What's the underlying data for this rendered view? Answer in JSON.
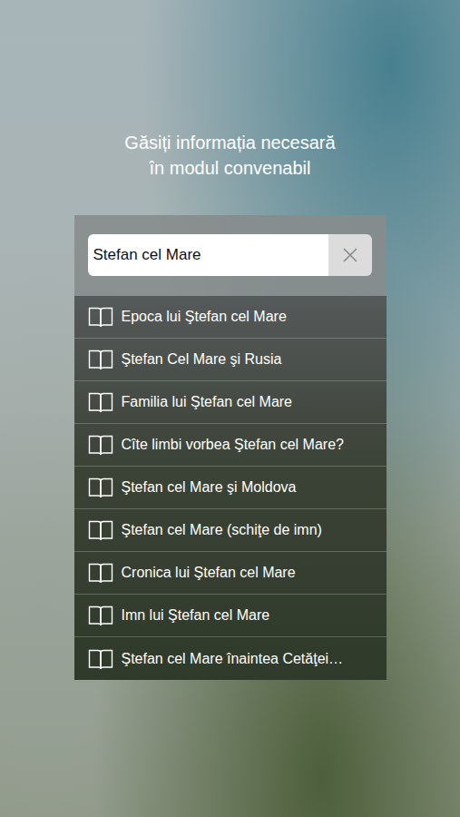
{
  "headline": [
    "Găsiți informația necesară",
    "în modul convenabil"
  ],
  "search": {
    "value": "Stefan cel Mare"
  },
  "results": [
    {
      "title": "Epoca lui Ştefan cel Mare"
    },
    {
      "title": "Ştefan Cel Mare şi Rusia"
    },
    {
      "title": "Familia lui Ştefan cel Mare"
    },
    {
      "title": "Cîte limbi vorbea Ştefan cel Mare?"
    },
    {
      "title": "Ştefan cel Mare şi Moldova"
    },
    {
      "title": "Ştefan cel Mare (schiţe de imn)"
    },
    {
      "title": "Cronica lui Ştefan cel Mare"
    },
    {
      "title": "Imn lui Ştefan cel Mare"
    },
    {
      "title": "Ştefan cel Mare înaintea Cetăţei…"
    }
  ]
}
